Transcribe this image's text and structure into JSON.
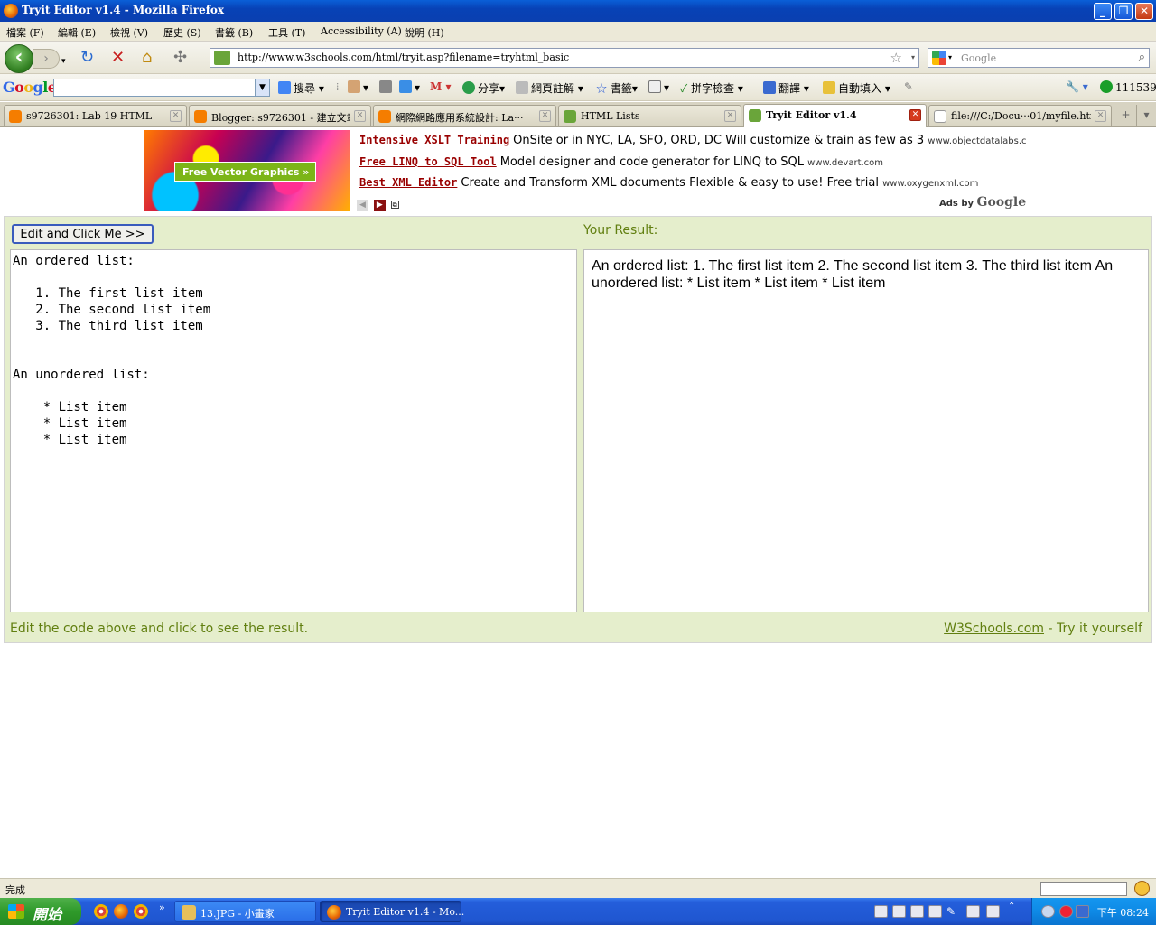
{
  "window": {
    "title": "Tryit Editor v1.4 - Mozilla Firefox"
  },
  "menu": [
    "檔案 (F)",
    "編輯 (E)",
    "檢視 (V)",
    "歷史 (S)",
    "書籤 (B)",
    "工具 (T)",
    "Accessibility (A)",
    "說明 (H)"
  ],
  "nav": {
    "url": "http://www.w3schools.com/html/tryit.asp?filename=tryhtml_basic",
    "search_placeholder": "Google"
  },
  "google_toolbar": {
    "logo": "Google",
    "search": "搜尋",
    "share": "分享",
    "notes": "網頁註解",
    "bookmarks": "書籤",
    "spellcheck": "拼字檢查",
    "translate": "翻譯",
    "autofill": "自動填入",
    "count": "111539"
  },
  "tabs": [
    {
      "label": "s9726301: Lab 19 HTML",
      "active": false
    },
    {
      "label": "Blogger: s9726301 - 建立文章",
      "active": false
    },
    {
      "label": "網際網路應用系統設計: La···",
      "active": false
    },
    {
      "label": "HTML Lists",
      "active": false
    },
    {
      "label": "Tryit Editor v1.4",
      "active": true
    },
    {
      "label": "file:///C:/Docu···01/myfile.html",
      "active": false
    }
  ],
  "ads": {
    "banner_button": "Free Vector Graphics  »",
    "lines": [
      {
        "title": "Intensive XSLT Training",
        "text": "OnSite or in NYC, LA, SFO, ORD, DC Will customize & train as few as 3",
        "url": "www.objectdatalabs.c"
      },
      {
        "title": "Free LINQ to SQL Tool",
        "text": "Model designer and code generator for LINQ to SQL",
        "url": "www.devart.com"
      },
      {
        "title": "Best XML Editor",
        "text": "Create and Transform XML documents Flexible & easy to use! Free trial",
        "url": "www.oxygenxml.com"
      }
    ],
    "ads_by": "Ads by",
    "ads_by_brand": "Google"
  },
  "tryit": {
    "button": "Edit and Click Me >>",
    "result_label": "Your Result:",
    "code": "An ordered list:\n\n   1. The first list item\n   2. The second list item\n   3. The third list item\n\n\nAn unordered list:\n\n    * List item\n    * List item\n    * List item",
    "result": "An ordered list: 1. The first list item 2. The second list item 3. The third list item An unordered list: * List item * List item * List item",
    "footer_left": "Edit the code above and click to see the result.",
    "footer_link": "W3Schools.com",
    "footer_right_suffix": " - Try it yourself"
  },
  "status": {
    "text": "完成"
  },
  "taskbar": {
    "start": "開始",
    "tasks": [
      {
        "label": "13.JPG - 小畫家",
        "active": false
      },
      {
        "label": "Tryit Editor v1.4 - Mo...",
        "active": true
      }
    ],
    "clock": "下午 08:24"
  }
}
